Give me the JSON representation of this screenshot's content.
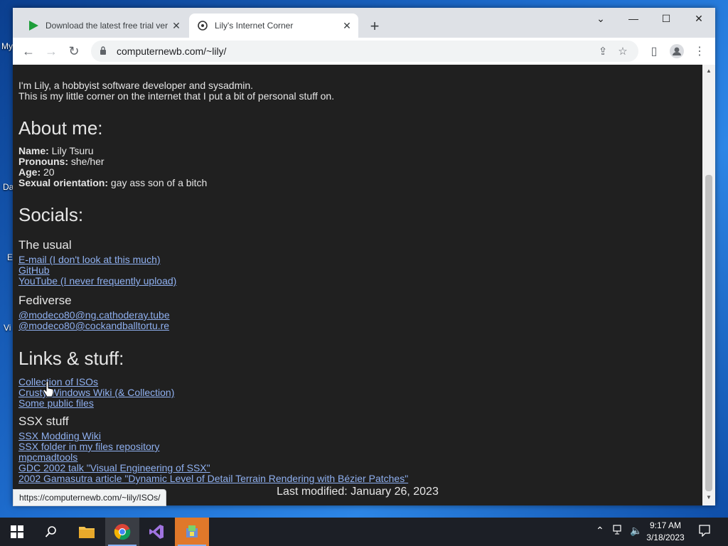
{
  "desktop": {
    "icon_labels": [
      "My",
      "Da",
      "E",
      "Vi"
    ]
  },
  "browser": {
    "tabs": [
      {
        "title": "Download the latest free trial ver",
        "active": false
      },
      {
        "title": "Lily's Internet Corner",
        "active": true
      }
    ],
    "address": "computernewb.com/~lily/",
    "status_url": "https://computernewb.com/~lily/ISOs/"
  },
  "page": {
    "intro_lines": [
      "I'm Lily, a hobbyist software developer and sysadmin.",
      "This is my little corner on the internet that I put a bit of personal stuff on."
    ],
    "about": {
      "heading": "About me:",
      "name_label": "Name:",
      "name_value": " Lily Tsuru",
      "pronouns_label": "Pronouns:",
      "pronouns_value": " she/her",
      "age_label": "Age:",
      "age_value": " 20",
      "orientation_label": "Sexual orientation:",
      "orientation_value": " gay ass son of a bitch"
    },
    "socials": {
      "heading": "Socials:",
      "usual_heading": "The usual",
      "usual_links": [
        "E-mail (I don't look at this much)",
        "GitHub",
        "YouTube (I never frequently upload)"
      ],
      "fediverse_heading": "Fediverse",
      "fediverse_links": [
        "@modeco80@ng.cathoderay.tube",
        "@modeco80@cockandballtortu.re"
      ]
    },
    "links": {
      "heading": "Links & stuff:",
      "main_links": [
        "Collection of ISOs",
        "Crusty Windows Wiki (& Collection)",
        "Some public files"
      ],
      "ssx_heading": "SSX stuff",
      "ssx_links": [
        "SSX Modding Wiki",
        "SSX folder in my files repository",
        "mpcmadtools",
        "GDC 2002 talk \"Visual Engineering of SSX\"",
        "2002 Gamasutra article \"Dynamic Level of Detail Terrain Rendering with Bézier Patches\""
      ]
    },
    "last_modified": "Last modified: January 26, 2023"
  },
  "taskbar": {
    "time": "9:17 AM",
    "date": "3/18/2023"
  }
}
